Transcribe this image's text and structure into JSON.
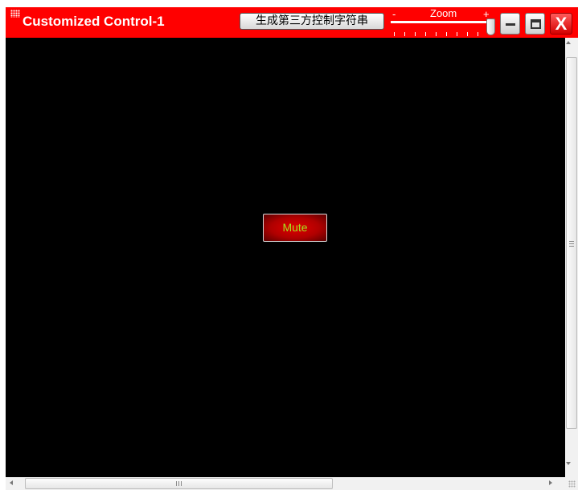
{
  "window": {
    "title": "Customized Control-1",
    "generate_button_label": "生成第三方控制字符串"
  },
  "zoom": {
    "label": "Zoom",
    "minus_label": "-",
    "plus_label": "+",
    "level": 1.0
  },
  "window_buttons": {
    "minimize_icon": "minimize-icon",
    "maximize_icon": "maximize-icon",
    "close_glyph": "X"
  },
  "client": {
    "mute_button_label": "Mute"
  },
  "scrollbars": {
    "horizontal_grip_icon": "grip-icon",
    "vertical_grip_icon": "grip-icon"
  },
  "colors": {
    "titlebar": "#ff0000",
    "client_background": "#000000",
    "mute_text": "#a5e01e",
    "mute_button": "#c00000"
  }
}
